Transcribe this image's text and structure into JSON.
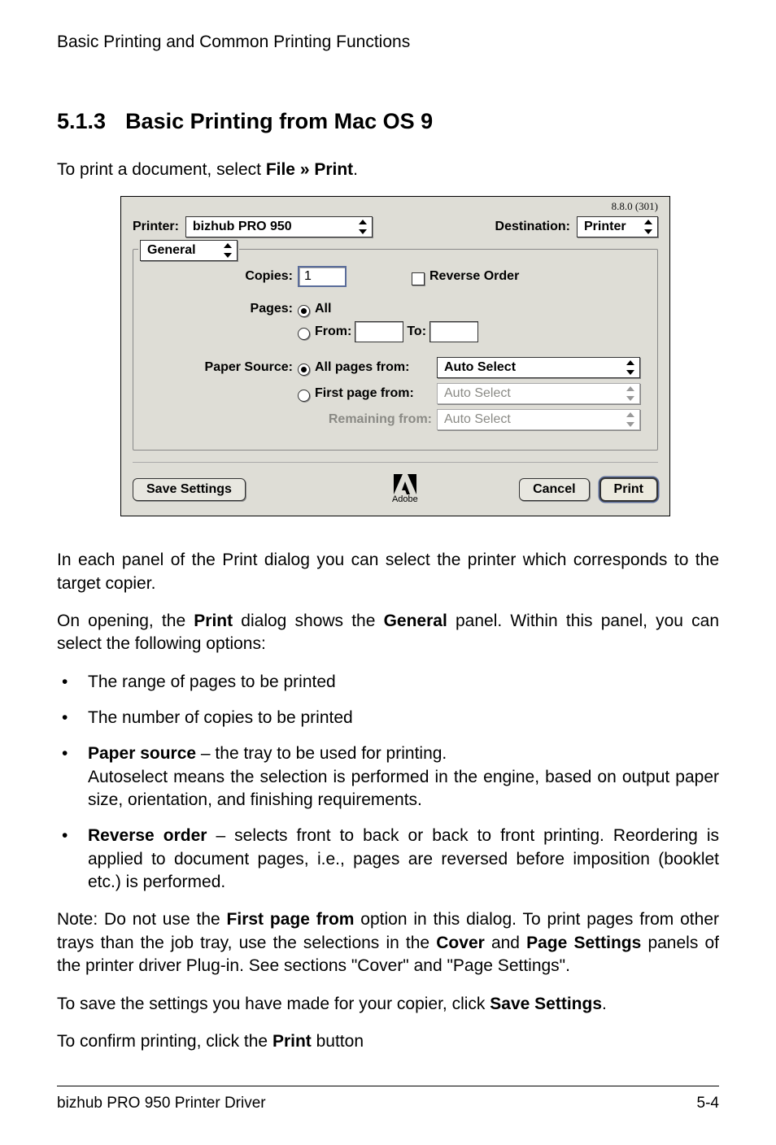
{
  "header": {
    "breadcrumb": "Basic Printing and Common Printing Functions"
  },
  "heading": {
    "num": "5.1.3",
    "title": "Basic Printing from Mac OS 9"
  },
  "intro": {
    "prefix": "To print a document, select ",
    "bold": "File » Print",
    "suffix": "."
  },
  "dialog": {
    "version": "8.8.0 (301)",
    "printer_label": "Printer:",
    "printer_value": "bizhub PRO 950",
    "destination_label": "Destination:",
    "destination_value": "Printer",
    "panel_value": "General",
    "copies_label": "Copies:",
    "copies_value": "1",
    "reverse_label": "Reverse Order",
    "pages_label": "Pages:",
    "pages_all": "All",
    "pages_from_label": "From:",
    "pages_from_value": "",
    "pages_to_label": "To:",
    "pages_to_value": "",
    "papersource_label": "Paper Source:",
    "ps_allpages_label": "All pages from:",
    "ps_allpages_value": "Auto Select",
    "ps_first_label": "First page from:",
    "ps_first_value": "Auto Select",
    "ps_remaining_label": "Remaining from:",
    "ps_remaining_value": "Auto Select",
    "save_settings": "Save Settings",
    "adobe_text": "Adobe",
    "cancel": "Cancel",
    "print": "Print"
  },
  "p1": "In each panel of the Print dialog you can select the printer which corresponds to the target copier.",
  "p2": {
    "a": "On opening, the ",
    "b": "Print",
    "c": " dialog shows the ",
    "d": "General",
    "e": " panel. Within this panel, you can select the following options:"
  },
  "list": {
    "i1": "The range of pages to be printed",
    "i2": "The number of copies to be printed",
    "i3_b": "Paper source",
    "i3_rest": " – the tray to be used for printing.\nAutoselect means the selection is performed in the engine, based on output paper size, orientation, and finishing requirements.",
    "i4_b": "Reverse order",
    "i4_rest": " – selects front to back or back to front printing. Reordering is applied to document pages, i.e., pages are reversed before imposition (booklet etc.) is performed."
  },
  "p3": {
    "a": "Note: Do not use the ",
    "b": "First page from",
    "c": " option in this dialog. To print pages from other trays than the job tray, use the selections in the ",
    "d": "Cover",
    "e": " and ",
    "f": "Page Settings",
    "g": " panels of the printer driver Plug-in. See sections \"Cover\" and \"Page Settings\"."
  },
  "p4": {
    "a": "To save the settings you have made for your copier, click ",
    "b": "Save Settings",
    "c": "."
  },
  "p5": {
    "a": "To confirm printing, click the ",
    "b": "Print",
    "c": " button"
  },
  "footer": {
    "left": "bizhub PRO 950 Printer Driver",
    "right": "5-4"
  }
}
